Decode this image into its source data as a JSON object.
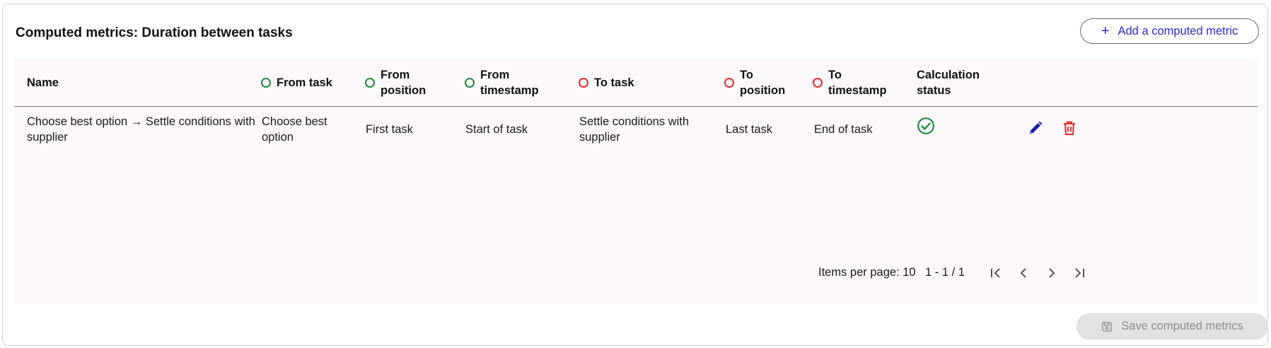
{
  "header": {
    "title": "Computed metrics: Duration between tasks",
    "add_button_label": "Add a computed metric",
    "add_button_icon": "plus-icon"
  },
  "colors": {
    "accent": "#2b2bd1",
    "from_indicator": "#1f8a3b",
    "to_indicator": "#e02d2d",
    "delete": "#e02d2d",
    "edit": "#1a1aa8",
    "table_background": "#fcf8fc"
  },
  "table": {
    "columns": {
      "name": "Name",
      "from_task": "From task",
      "from_position": [
        "From",
        "position"
      ],
      "from_timestamp": [
        "From",
        "timestamp"
      ],
      "to_task": "To task",
      "to_position": [
        "To",
        "position"
      ],
      "to_timestamp": [
        "To",
        "timestamp"
      ],
      "calculation_status": [
        "Calculation",
        "status"
      ]
    },
    "rows": [
      {
        "name": [
          "Choose best option → Settle conditions with",
          "supplier"
        ],
        "from_task": [
          "Choose best",
          "option"
        ],
        "from_position": "First task",
        "from_timestamp": "Start of task",
        "to_task": [
          "Settle conditions with",
          "supplier"
        ],
        "to_position": "Last task",
        "to_timestamp": "End of task",
        "status_icon": "check-circle-icon",
        "edit_icon": "pencil-icon",
        "delete_icon": "trash-icon"
      }
    ]
  },
  "pagination": {
    "items_per_page_label": "Items per page: 10",
    "range": "1 - 1 / 1"
  },
  "footer": {
    "save_button_label": "Save computed metrics",
    "save_button_icon": "save-icon"
  }
}
